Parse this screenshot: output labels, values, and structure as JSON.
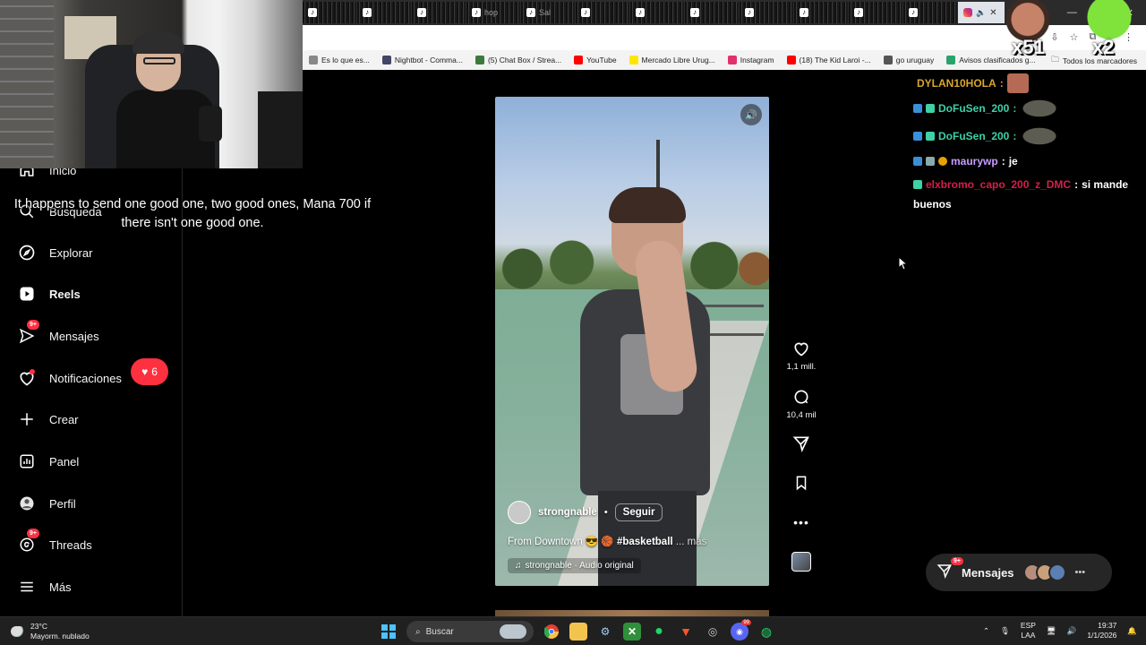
{
  "browser": {
    "tabs": [
      {
        "label": ""
      },
      {
        "label": ""
      },
      {
        "label": ""
      },
      {
        "label": "hop"
      },
      {
        "label": "Sal"
      },
      {
        "label": ""
      },
      {
        "label": ""
      },
      {
        "label": ""
      },
      {
        "label": ""
      },
      {
        "label": ""
      },
      {
        "label": ""
      },
      {
        "label": ""
      }
    ],
    "active_tab_close": "✕",
    "window_controls": [
      "—",
      "☐",
      "✕"
    ],
    "bookmarks": [
      {
        "label": "Es lo que es...",
        "color": "#888888"
      },
      {
        "label": "Nightbot - Comma...",
        "color": "#444466"
      },
      {
        "label": "(5) Chat Box / Strea...",
        "color": "#3a7a3a"
      },
      {
        "label": "YouTube",
        "color": "#ff0000"
      },
      {
        "label": "Mercado Libre Urug...",
        "color": "#ffe600"
      },
      {
        "label": "Instagram",
        "color": "#e1306c"
      },
      {
        "label": "(18) The Kid Laroi -...",
        "color": "#ff0000"
      },
      {
        "label": "go uruguay",
        "color": "#555555"
      },
      {
        "label": "Avisos clasificados g...",
        "color": "#2aa36b"
      }
    ],
    "bookmarks_all": "Todos los marcadores"
  },
  "sidebar": {
    "items": [
      {
        "label": "Inicio",
        "icon": "home-icon"
      },
      {
        "label": "Búsqueda",
        "icon": "search-icon"
      },
      {
        "label": "Explorar",
        "icon": "compass-icon"
      },
      {
        "label": "Reels",
        "icon": "reels-icon"
      },
      {
        "label": "Mensajes",
        "icon": "send-icon",
        "badge": "9+"
      },
      {
        "label": "Notificaciones",
        "icon": "heart-icon"
      },
      {
        "label": "Crear",
        "icon": "plus-icon"
      },
      {
        "label": "Panel",
        "icon": "chart-icon"
      },
      {
        "label": "Perfil",
        "icon": "avatar-icon"
      },
      {
        "label": "Threads",
        "icon": "threads-icon",
        "badge": "9+"
      },
      {
        "label": "Más",
        "icon": "menu-icon"
      }
    ],
    "notification_pill_count": "6"
  },
  "reel": {
    "username": "strongnable",
    "separator": "•",
    "follow_label": "Seguir",
    "caption_text": "From Downtown 😎 🏀",
    "caption_hashtag": "#basketball",
    "caption_more": "... más",
    "audio_label": "strongnable · Audio original"
  },
  "actions": {
    "likes": "1,1 mill.",
    "comments": "10,4 mil"
  },
  "messages_pill": {
    "label": "Mensajes",
    "badge": "9+",
    "avatar_colors": [
      "#b78e7c",
      "#caa07a",
      "#5a7fb0"
    ]
  },
  "overlay": {
    "subtitle": "It happens to send one good one, two good ones, Mana 700 if there isn't one good one.",
    "emote1_text": "x51",
    "emote2_text": "x2"
  },
  "chat": [
    {
      "user": "DYLAN10HOLA",
      "sep": ":",
      "msg": "",
      "color": "#d9a62e"
    },
    {
      "user": "DoFuSen_200",
      "sep": ":",
      "msg": "",
      "color": "#3fd0a6"
    },
    {
      "user": "DoFuSen_200",
      "sep": ":",
      "msg": "",
      "color": "#3fd0a6"
    },
    {
      "user": "maurywp",
      "sep": ":",
      "msg": "je",
      "color": "#c79cff"
    },
    {
      "user": "elxbromo_capo_200_z_DMC",
      "sep": ":",
      "msg": "si mande",
      "msg2": "buenos",
      "color": "#d4204a"
    }
  ],
  "taskbar": {
    "weather_temp": "23°C",
    "weather_desc": "Mayorm. nublado",
    "search_label": "Buscar",
    "lang1": "ESP",
    "lang2": "LAA",
    "time": "19:37",
    "date": "1/1/2026",
    "discord_badge": "99"
  }
}
